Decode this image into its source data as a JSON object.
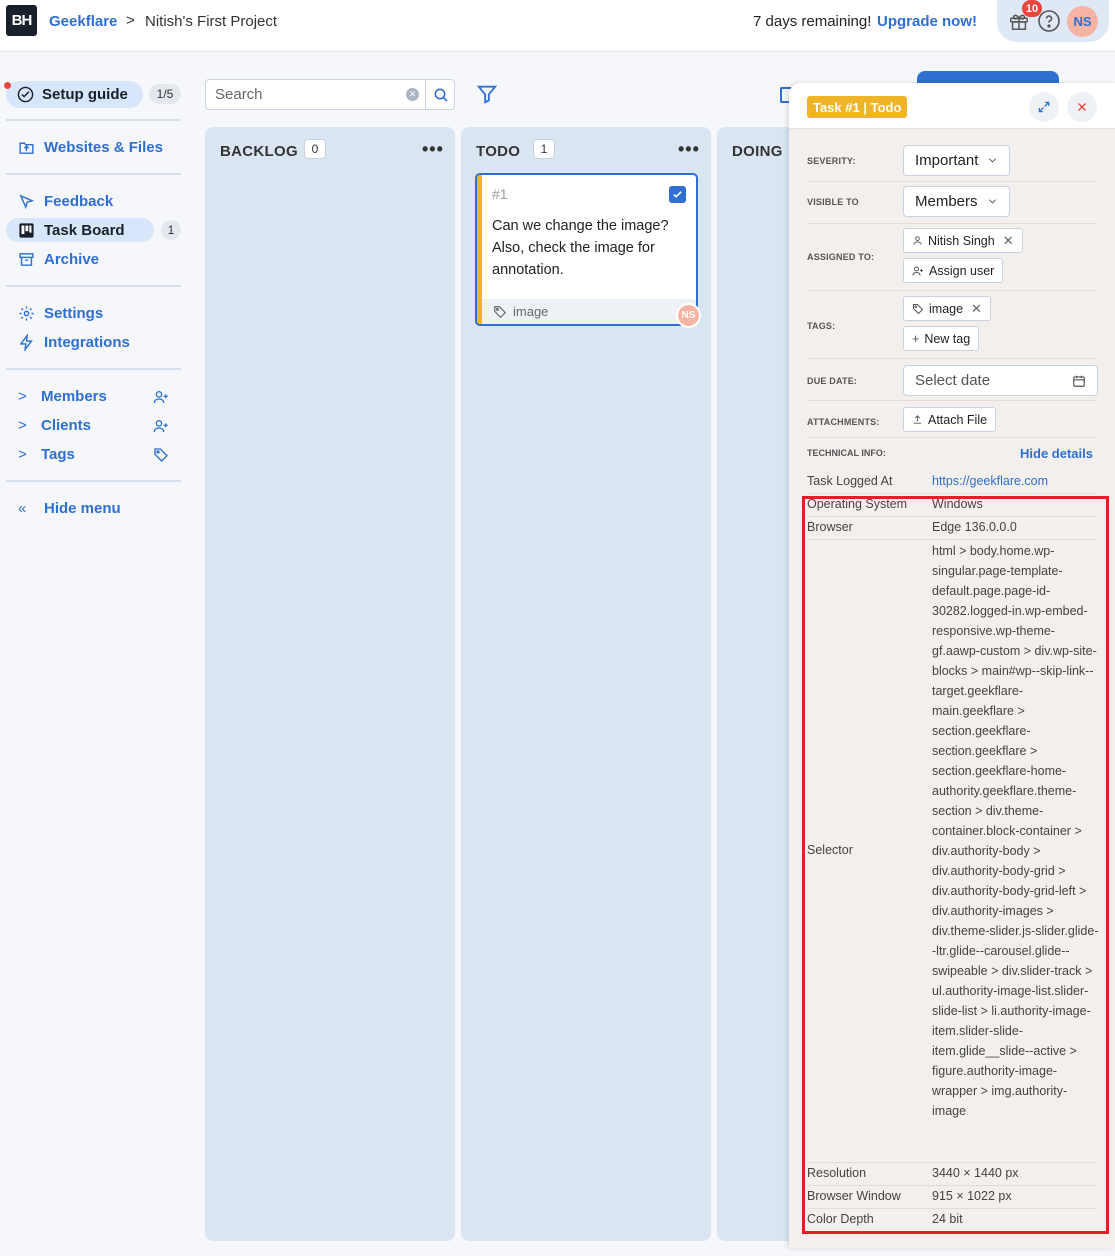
{
  "header": {
    "logo": "BH",
    "org": "Geekflare",
    "separator": ">",
    "project": "Nitish's First Project",
    "trial": "7 days remaining!",
    "upgrade": "Upgrade now!",
    "gift_badge": "10",
    "avatar_initials": "NS",
    "icons": [
      "gift-icon",
      "help-icon"
    ]
  },
  "sidebar": {
    "setup_guide": {
      "label": "Setup guide",
      "progress": "1/5"
    },
    "items": [
      {
        "label": "Websites & Files",
        "icon": "upload-folder-icon"
      },
      {
        "label": "Feedback",
        "icon": "cursor-icon"
      },
      {
        "label": "Task Board",
        "icon": "board-icon",
        "count": "1",
        "active": true
      },
      {
        "label": "Archive",
        "icon": "archive-icon"
      },
      {
        "label": "Settings",
        "icon": "gear-icon"
      },
      {
        "label": "Integrations",
        "icon": "bolt-icon"
      }
    ],
    "groups": [
      {
        "label": "Members",
        "icon": "add-person-icon"
      },
      {
        "label": "Clients",
        "icon": "add-person-icon"
      },
      {
        "label": "Tags",
        "icon": "tag-icon"
      }
    ],
    "hide_menu": "Hide menu"
  },
  "board": {
    "search": {
      "placeholder": "Search",
      "value": ""
    },
    "columns": [
      {
        "title": "BACKLOG",
        "count": "0",
        "more": "•••"
      },
      {
        "title": "TODO",
        "count": "1",
        "more": "•••"
      },
      {
        "title": "DOING"
      }
    ],
    "card": {
      "id": "#1",
      "text": "Can we change the image? Also, check the image for annotation.",
      "tag": "image",
      "avatar": "NS",
      "accent": "#f0b429"
    }
  },
  "panel": {
    "badge": "Task #1 | Todo",
    "severity": {
      "label": "SEVERITY:",
      "value": "Important"
    },
    "visible_to": {
      "label": "VISIBLE TO",
      "value": "Members"
    },
    "assigned_to": {
      "label": "ASSIGNED TO:",
      "user": "Nitish Singh",
      "assign_btn": "Assign user"
    },
    "tags": {
      "label": "TAGS:",
      "tag": "image",
      "new_tag": "New tag"
    },
    "due_date": {
      "label": "DUE DATE:",
      "placeholder": "Select date"
    },
    "attachments": {
      "label": "ATTACHMENTS:",
      "button": "Attach File"
    },
    "technical": {
      "label": "TECHNICAL INFO:",
      "hide": "Hide details",
      "rows": [
        {
          "key": "Task Logged At",
          "value": "https://geekflare.com"
        },
        {
          "key": "Operating System",
          "value": "Windows"
        },
        {
          "key": "Browser",
          "value": "Edge 136.0.0.0"
        },
        {
          "key": "Selector",
          "value": "html > body.home.wp-singular.page-template-default.page.page-id-30282.logged-in.wp-embed-responsive.wp-theme-gf.aawp-custom > div.wp-site-blocks > main#wp--skip-link--target.geekflare-main.geekflare > section.geekflare-section.geekflare > section.geekflare-home-authority.geekflare.theme-section > div.theme-container.block-container > div.authority-body > div.authority-body-grid > div.authority-body-grid-left > div.authority-images > div.theme-slider.js-slider.glide--ltr.glide--carousel.glide--swipeable > div.slider-track > ul.authority-image-list.slider-slide-list > li.authority-image-item.slider-slide-item.glide__slide--active > figure.authority-image-wrapper > img.authority-image"
        },
        {
          "key": "Resolution",
          "value": "3440 × 1440 px"
        },
        {
          "key": "Browser Window",
          "value": "915 × 1022 px"
        },
        {
          "key": "Color Depth",
          "value": "24 bit"
        }
      ]
    }
  },
  "colors": {
    "brand": "#2f6fd1",
    "accent": "#f0b429",
    "highlight": "#e01f26"
  }
}
